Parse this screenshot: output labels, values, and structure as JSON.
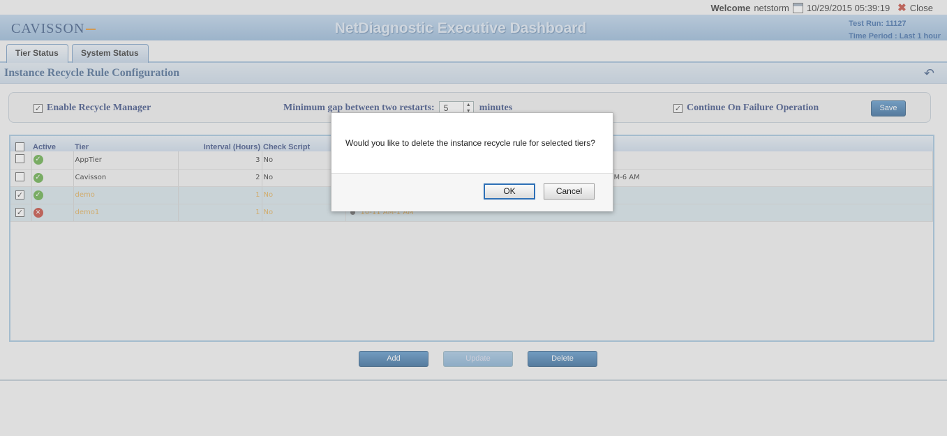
{
  "topbar": {
    "welcome": "Welcome",
    "user": "netstorm",
    "datetime": "10/29/2015 05:39:19",
    "close": "Close"
  },
  "header": {
    "logo": "CAVISSON",
    "title": "NetDiagnostic Executive Dashboard",
    "test_run": "Test Run: 11127",
    "time_period": "Time Period : Last 1 hour"
  },
  "tabs": [
    {
      "label": "Tier Status"
    },
    {
      "label": "System Status"
    }
  ],
  "section": {
    "title": "Instance Recycle Rule Configuration"
  },
  "config": {
    "enable_label": "Enable Recycle Manager",
    "enable_checked": true,
    "gap_label": "Minimum gap between two restarts:",
    "gap_value": "5",
    "gap_unit": "minutes",
    "continue_label": "Continue On Failure Operation",
    "continue_checked": true,
    "save": "Save"
  },
  "table": {
    "headers": {
      "active": "Active",
      "tier": "Tier",
      "interval": "Interval (Hours)",
      "check_script": "Check Script"
    },
    "rows": [
      {
        "checked": false,
        "active": "ok",
        "tier": "AppTier",
        "interval": "3",
        "check_script": "No",
        "schedule": ""
      },
      {
        "checked": false,
        "active": "ok",
        "tier": "Cavisson",
        "interval": "2",
        "check_script": "No",
        "schedule": "M-6 AM"
      },
      {
        "checked": true,
        "active": "ok",
        "tier": "demo",
        "interval": "1",
        "check_script": "No",
        "schedule": ""
      },
      {
        "checked": true,
        "active": "error",
        "tier": "demo1",
        "interval": "1",
        "check_script": "No",
        "schedule": "10-11 AM-1 AM"
      }
    ]
  },
  "actions": {
    "add": "Add",
    "update": "Update",
    "delete": "Delete"
  },
  "dialog": {
    "message": "Would you like to delete the instance recycle rule for selected tiers?",
    "ok": "OK",
    "cancel": "Cancel"
  }
}
